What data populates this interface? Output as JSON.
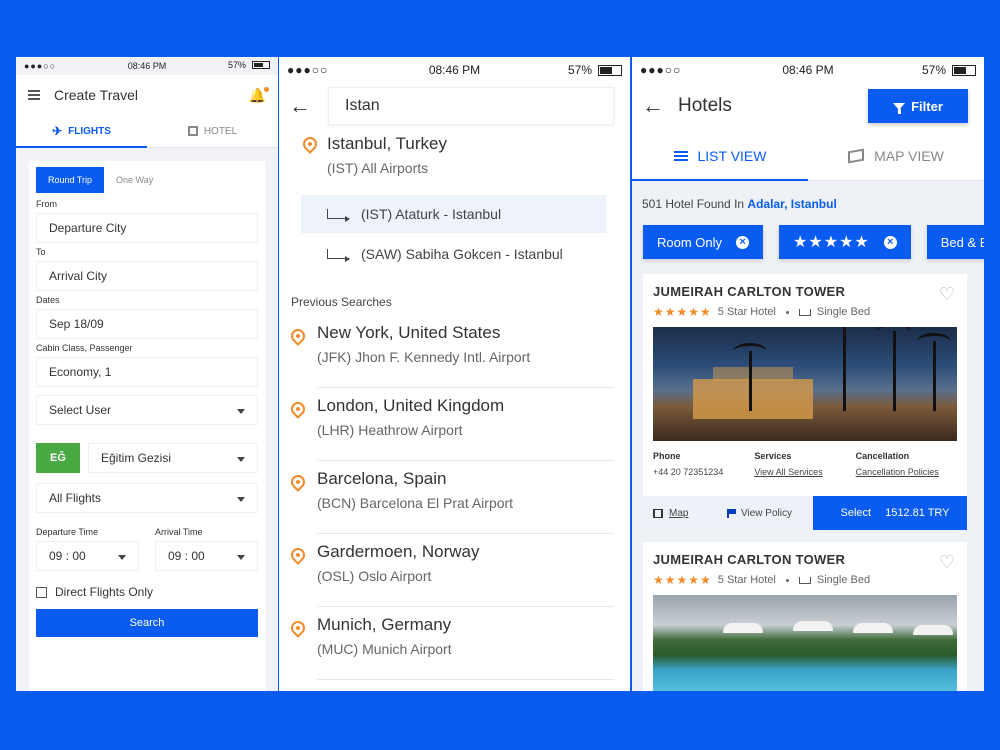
{
  "status": {
    "time": "08:46 PM",
    "battery": "57%",
    "signal": "●●●○○"
  },
  "create_travel": {
    "title": "Create Travel",
    "tabs": [
      {
        "label": "FLIGHTS",
        "active": true
      },
      {
        "label": "HOTEL",
        "active": false
      }
    ],
    "trip_type": {
      "round_trip": "Round Trip",
      "one_way": "One Way"
    },
    "from_label": "From",
    "from_value": "Departure City",
    "to_label": "To",
    "to_value": "Arrival City",
    "dates_label": "Dates",
    "dates_value": "Sep 18/09",
    "cabin_label": "Cabin Class, Passenger",
    "cabin_value": "Economy, 1",
    "select_user": "Select User",
    "purpose_badge": "EĞ",
    "purpose_value": "Eğitim Gezisi",
    "flights_filter": "All Flights",
    "departure_time_label": "Departure Time",
    "departure_time_value": "09 : 00",
    "arrival_time_label": "Arrival Time",
    "arrival_time_value": "09 : 00",
    "direct_flights": "Direct Flights Only",
    "search_button": "Search"
  },
  "airport_search": {
    "query": "Istan",
    "top_match": {
      "title": "Istanbul, Turkey",
      "sub": "(IST) All Airports"
    },
    "airports": [
      {
        "label": "(IST) Ataturk - Istanbul",
        "highlighted": true
      },
      {
        "label": "(SAW) Sabiha Gokcen - Istanbul",
        "highlighted": false
      }
    ],
    "previous_title": "Previous Searches",
    "previous": [
      {
        "title": "New York, United States",
        "sub": "(JFK) Jhon F. Kennedy Intl. Airport"
      },
      {
        "title": "London, United Kingdom",
        "sub": "(LHR) Heathrow Airport"
      },
      {
        "title": "Barcelona, Spain",
        "sub": "(BCN) Barcelona El Prat Airport"
      },
      {
        "title": "Gardermoen, Norway",
        "sub": "(OSL) Oslo Airport"
      },
      {
        "title": "Munich, Germany",
        "sub": "(MUC) Munich Airport"
      }
    ]
  },
  "hotels": {
    "title": "Hotels",
    "filter_button": "Filter",
    "tabs": [
      {
        "label": "LIST VIEW",
        "active": true
      },
      {
        "label": "MAP VIEW",
        "active": false
      }
    ],
    "found_prefix": "501 Hotel Found In",
    "found_location": "Adalar, Istanbul",
    "chips": [
      "Room Only",
      "★★★★★",
      "Bed & Br"
    ],
    "cards": [
      {
        "name": "JUMEIRAH CARLTON TOWER",
        "stars": "★★★★★",
        "class": "5 Star Hotel",
        "bed": "Single Bed",
        "phone_label": "Phone",
        "phone_value": "+44 20 72351234",
        "services_label": "Services",
        "services_value": "View All Services",
        "cancel_label": "Cancellation",
        "cancel_value": "Cancellation Policies",
        "map_label": "Map",
        "policy_label": "View Policy",
        "select_label": "Select",
        "price": "1512.81 TRY"
      },
      {
        "name": "JUMEIRAH CARLTON TOWER",
        "stars": "★★★★★",
        "class": "5 Star Hotel",
        "bed": "Single Bed"
      }
    ]
  }
}
